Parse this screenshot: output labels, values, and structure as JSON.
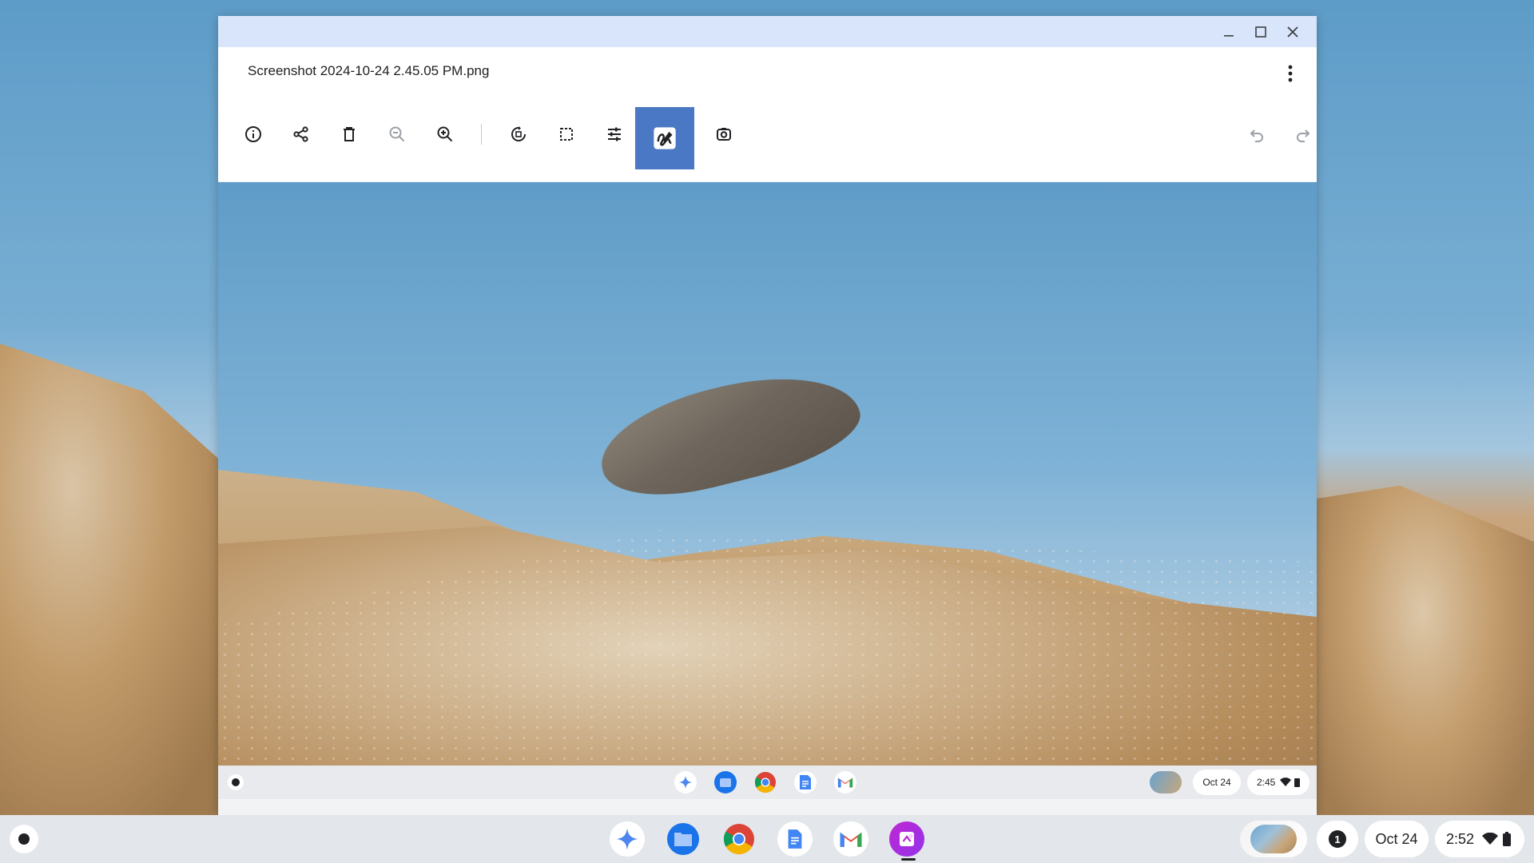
{
  "window": {
    "filename": "Screenshot 2024-10-24 2.45.05 PM.png",
    "controls": [
      "minimize-icon",
      "maximize-icon",
      "close-icon"
    ]
  },
  "toolbar": {
    "tools": [
      {
        "name": "info",
        "icon": "info-icon"
      },
      {
        "name": "share",
        "icon": "share-icon"
      },
      {
        "name": "delete",
        "icon": "trash-icon"
      },
      {
        "name": "zoom-out",
        "icon": "zoom-out-icon",
        "enabled": false
      },
      {
        "name": "zoom-in",
        "icon": "zoom-in-icon"
      },
      {
        "name": "rotate",
        "icon": "rotate-icon"
      },
      {
        "name": "crop",
        "icon": "crop-icon"
      },
      {
        "name": "adjust",
        "icon": "tune-icon"
      },
      {
        "name": "annotate",
        "icon": "markup-icon",
        "active": true
      },
      {
        "name": "lens",
        "icon": "lens-icon"
      },
      {
        "name": "undo",
        "icon": "undo-icon",
        "enabled": false
      },
      {
        "name": "redo",
        "icon": "redo-icon",
        "enabled": false
      }
    ],
    "active_color": "#4a78c4"
  },
  "inner_shelf": {
    "date": "Oct 24",
    "time": "2:45"
  },
  "shelf": {
    "apps": [
      "gemini-icon",
      "files-icon",
      "chrome-icon",
      "docs-icon",
      "gmail-icon",
      "screenshot-app-icon"
    ],
    "notification_count": "1",
    "date": "Oct 24",
    "time": "2:52"
  }
}
